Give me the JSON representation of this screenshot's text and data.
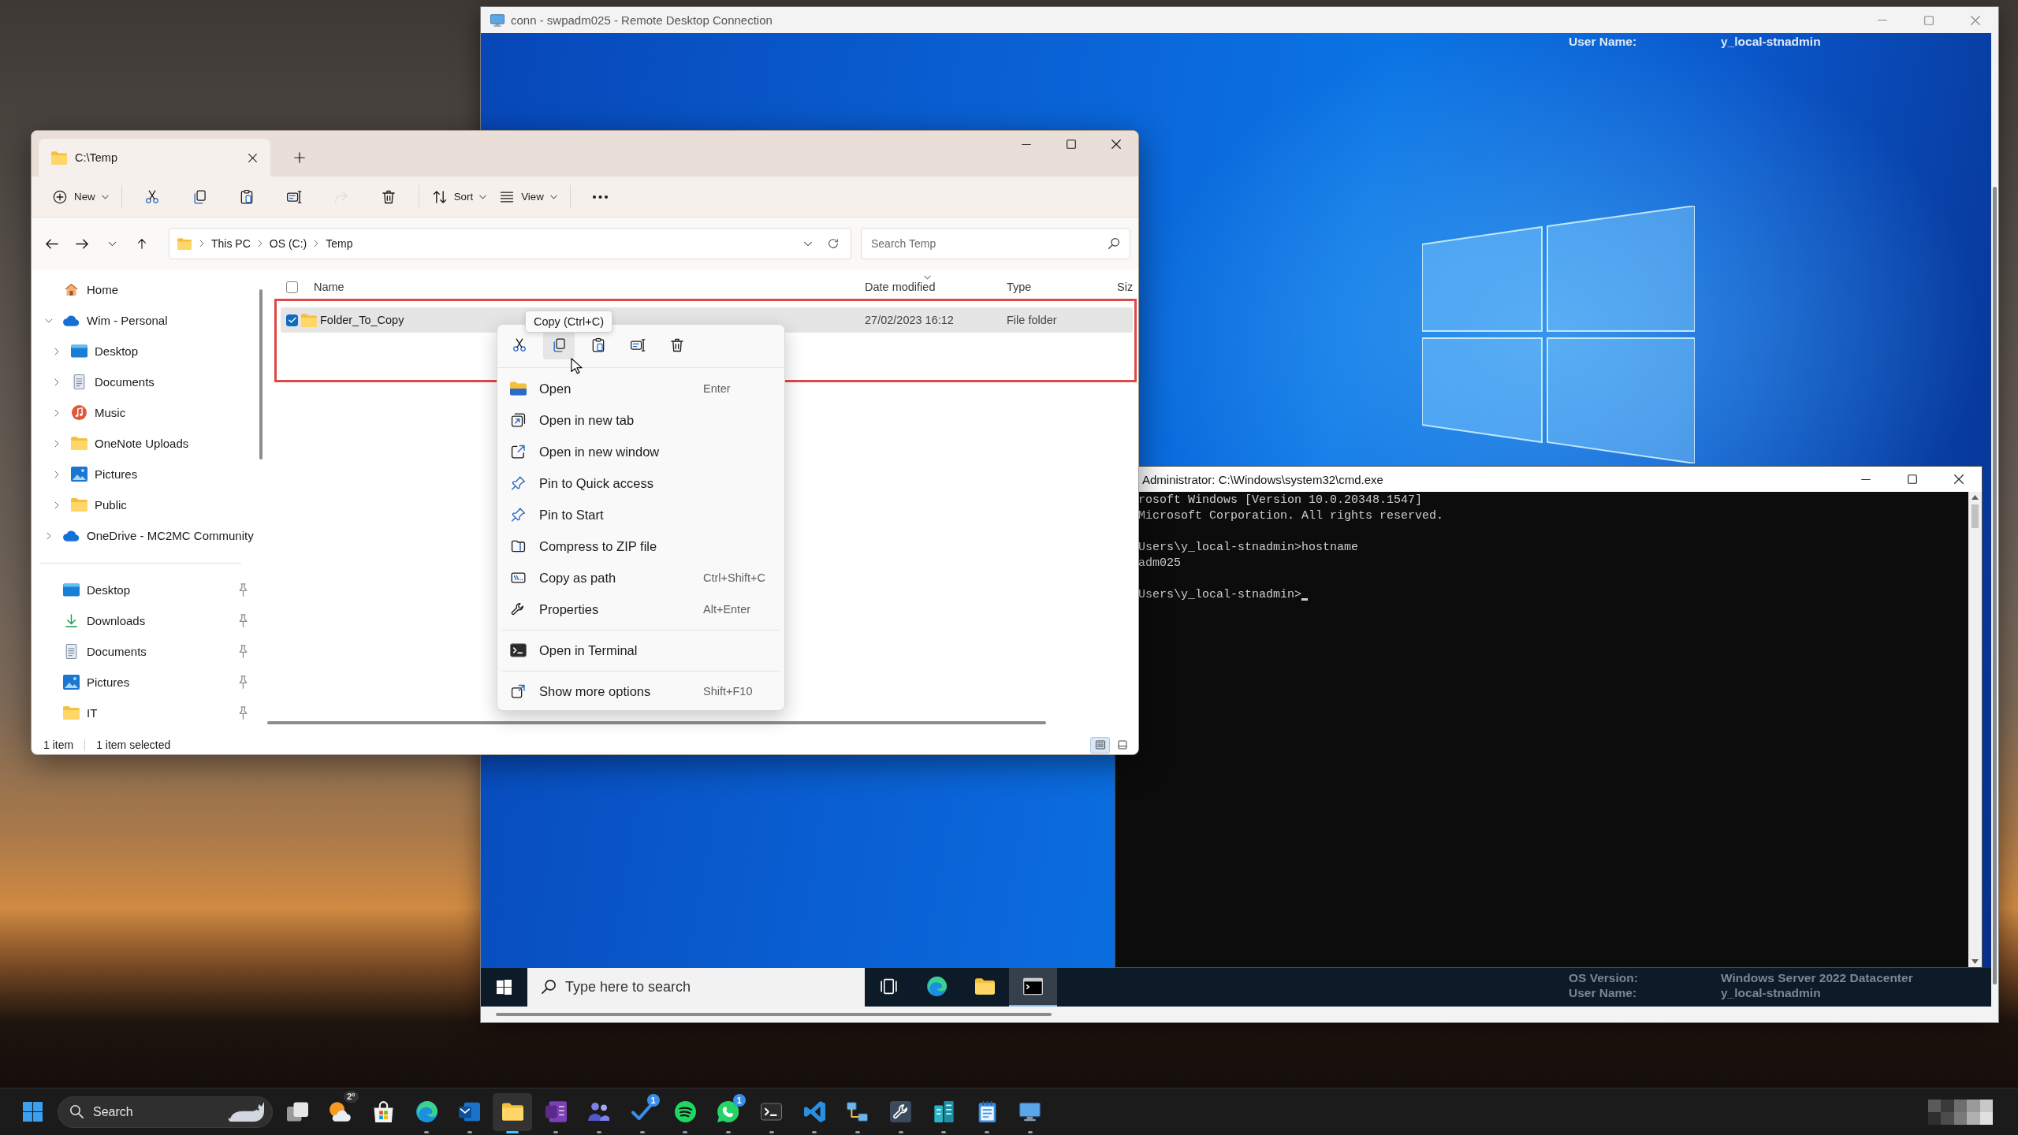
{
  "remote_window": {
    "title": "conn - swpadm025 - Remote Desktop Connection",
    "bginfo_top": [
      {
        "label": "User Name:",
        "value": "y_local-stnadmin"
      }
    ],
    "cmd_window": {
      "title": "Administrator: C:\\Windows\\system32\\cmd.exe",
      "paragraphs": [
        [
          "rosoft Windows [Version 10.0.20348.1547]",
          "Microsoft Corporation. All rights reserved."
        ],
        [
          "Users\\y_local-stnadmin>hostname",
          "adm025"
        ],
        [
          "Users\\y_local-stnadmin>"
        ]
      ],
      "cursor": true
    },
    "bginfo_bottom": [
      {
        "label": "OS Version:",
        "value": "Windows Server 2022 Datacenter"
      },
      {
        "label": "User Name:",
        "value": "y_local-stnadmin"
      }
    ],
    "taskbar": {
      "search": {
        "placeholder": "Type here to search"
      },
      "apps": [
        {
          "kind": "taskview",
          "active": false
        },
        {
          "kind": "browser",
          "active": false
        },
        {
          "kind": "folder",
          "active": false
        },
        {
          "kind": "console",
          "active": true
        }
      ]
    }
  },
  "explorer_window": {
    "tabs": [
      {
        "label": "C:\\Temp",
        "selected": true
      }
    ],
    "toolbar": [
      [
        {
          "kind": "new",
          "label": "New",
          "menu": true,
          "disabled": false
        }
      ],
      [
        {
          "kind": "cut",
          "disabled": false
        },
        {
          "kind": "copy",
          "disabled": false
        },
        {
          "kind": "paste",
          "disabled": false
        },
        {
          "kind": "rename",
          "disabled": false
        },
        {
          "kind": "share",
          "disabled": true
        },
        {
          "kind": "delete",
          "disabled": false
        }
      ],
      [
        {
          "kind": "sort",
          "label": "Sort",
          "menu": true,
          "disabled": false
        },
        {
          "kind": "view",
          "label": "View",
          "menu": true,
          "disabled": false
        }
      ],
      [
        {
          "kind": "more",
          "disabled": false
        }
      ]
    ],
    "address": {
      "path": [
        "This PC",
        "OS (C:)",
        "Temp"
      ]
    },
    "search": {
      "placeholder": "Search Temp"
    },
    "sidebar": {
      "tree": [
        {
          "kind": "home",
          "label": "Home"
        },
        {
          "kind": "cloud",
          "label": "Wim - Personal",
          "expanded": true,
          "children": [
            {
              "kind": "desktop",
              "label": "Desktop",
              "expanded": false
            },
            {
              "kind": "documents",
              "label": "Documents",
              "expanded": false
            },
            {
              "kind": "music",
              "label": "Music",
              "expanded": false
            },
            {
              "kind": "folder",
              "label": "OneNote Uploads",
              "expanded": false
            },
            {
              "kind": "pictures",
              "label": "Pictures",
              "expanded": false
            },
            {
              "kind": "folder",
              "label": "Public",
              "expanded": false
            }
          ]
        },
        {
          "kind": "cloud",
          "label": "OneDrive - MC2MC Community",
          "expanded": false
        }
      ],
      "pinned": [
        {
          "kind": "desktop",
          "label": "Desktop",
          "pinned": true
        },
        {
          "kind": "downloads",
          "label": "Downloads",
          "pinned": true
        },
        {
          "kind": "documents",
          "label": "Documents",
          "pinned": true
        },
        {
          "kind": "pictures",
          "label": "Pictures",
          "pinned": true
        },
        {
          "kind": "folder",
          "label": "IT",
          "pinned": true
        }
      ]
    },
    "file_list": {
      "header_checkbox": {
        "checked": false
      },
      "columns": [
        {
          "label": "Name",
          "sorted": false
        },
        {
          "label": "Date modified",
          "sorted": true
        },
        {
          "label": "Type",
          "sorted": false
        },
        {
          "label": "Siz",
          "sorted": false
        }
      ],
      "rows": [
        {
          "name": "Folder_To_Copy",
          "date_modified": "27/02/2023 16:12",
          "type": "File folder",
          "selected": true
        }
      ]
    },
    "context_menu": {
      "actions": [
        {
          "kind": "cut",
          "hovered": false
        },
        {
          "kind": "copy",
          "hovered": true
        },
        {
          "kind": "paste",
          "hovered": false
        },
        {
          "kind": "rename",
          "hovered": false
        },
        {
          "kind": "delete",
          "hovered": false
        }
      ],
      "groups": [
        [
          {
            "kind": "open",
            "label": "Open",
            "shortcut": "Enter"
          },
          {
            "kind": "newtab",
            "label": "Open in new tab"
          },
          {
            "kind": "newwindow",
            "label": "Open in new window"
          },
          {
            "kind": "pin",
            "label": "Pin to Quick access"
          },
          {
            "kind": "pin",
            "label": "Pin to Start"
          },
          {
            "kind": "zip",
            "label": "Compress to ZIP file"
          },
          {
            "kind": "path",
            "label": "Copy as path",
            "shortcut": "Ctrl+Shift+C"
          },
          {
            "kind": "properties",
            "label": "Properties",
            "shortcut": "Alt+Enter"
          }
        ],
        [
          {
            "kind": "terminal",
            "label": "Open in Terminal"
          }
        ],
        [
          {
            "kind": "moreoptions",
            "label": "Show more options",
            "shortcut": "Shift+F10"
          }
        ]
      ]
    },
    "tooltip": "Copy (Ctrl+C)",
    "status_bar": {
      "count": "1 item",
      "selection": "1 item selected",
      "views": [
        {
          "kind": "details",
          "selected": true
        },
        {
          "kind": "tiles",
          "selected": false
        }
      ]
    }
  },
  "taskbar": {
    "search": {
      "label": "Search"
    },
    "apps": [
      {
        "kind": "stack",
        "running": false,
        "active": false
      },
      {
        "kind": "weather",
        "running": false,
        "active": false,
        "temperature": "2°"
      },
      {
        "kind": "store",
        "running": false,
        "active": false
      },
      {
        "kind": "browser",
        "running": true,
        "active": false
      },
      {
        "kind": "mail",
        "running": true,
        "active": false
      },
      {
        "kind": "folder",
        "running": true,
        "active": true
      },
      {
        "kind": "notebook",
        "running": true,
        "active": false
      },
      {
        "kind": "people",
        "running": true,
        "active": false
      },
      {
        "kind": "todo",
        "running": true,
        "active": false,
        "badge": "1"
      },
      {
        "kind": "audio",
        "running": true,
        "active": false
      },
      {
        "kind": "chat",
        "running": true,
        "active": false,
        "badge": "1"
      },
      {
        "kind": "terminal",
        "running": true,
        "active": false
      },
      {
        "kind": "code",
        "running": true,
        "active": false
      },
      {
        "kind": "network",
        "running": true,
        "active": false
      },
      {
        "kind": "tools",
        "running": true,
        "active": false
      },
      {
        "kind": "building",
        "running": true,
        "active": false
      },
      {
        "kind": "notepad",
        "running": true,
        "active": false
      },
      {
        "kind": "remote",
        "running": true,
        "active": false
      }
    ]
  }
}
